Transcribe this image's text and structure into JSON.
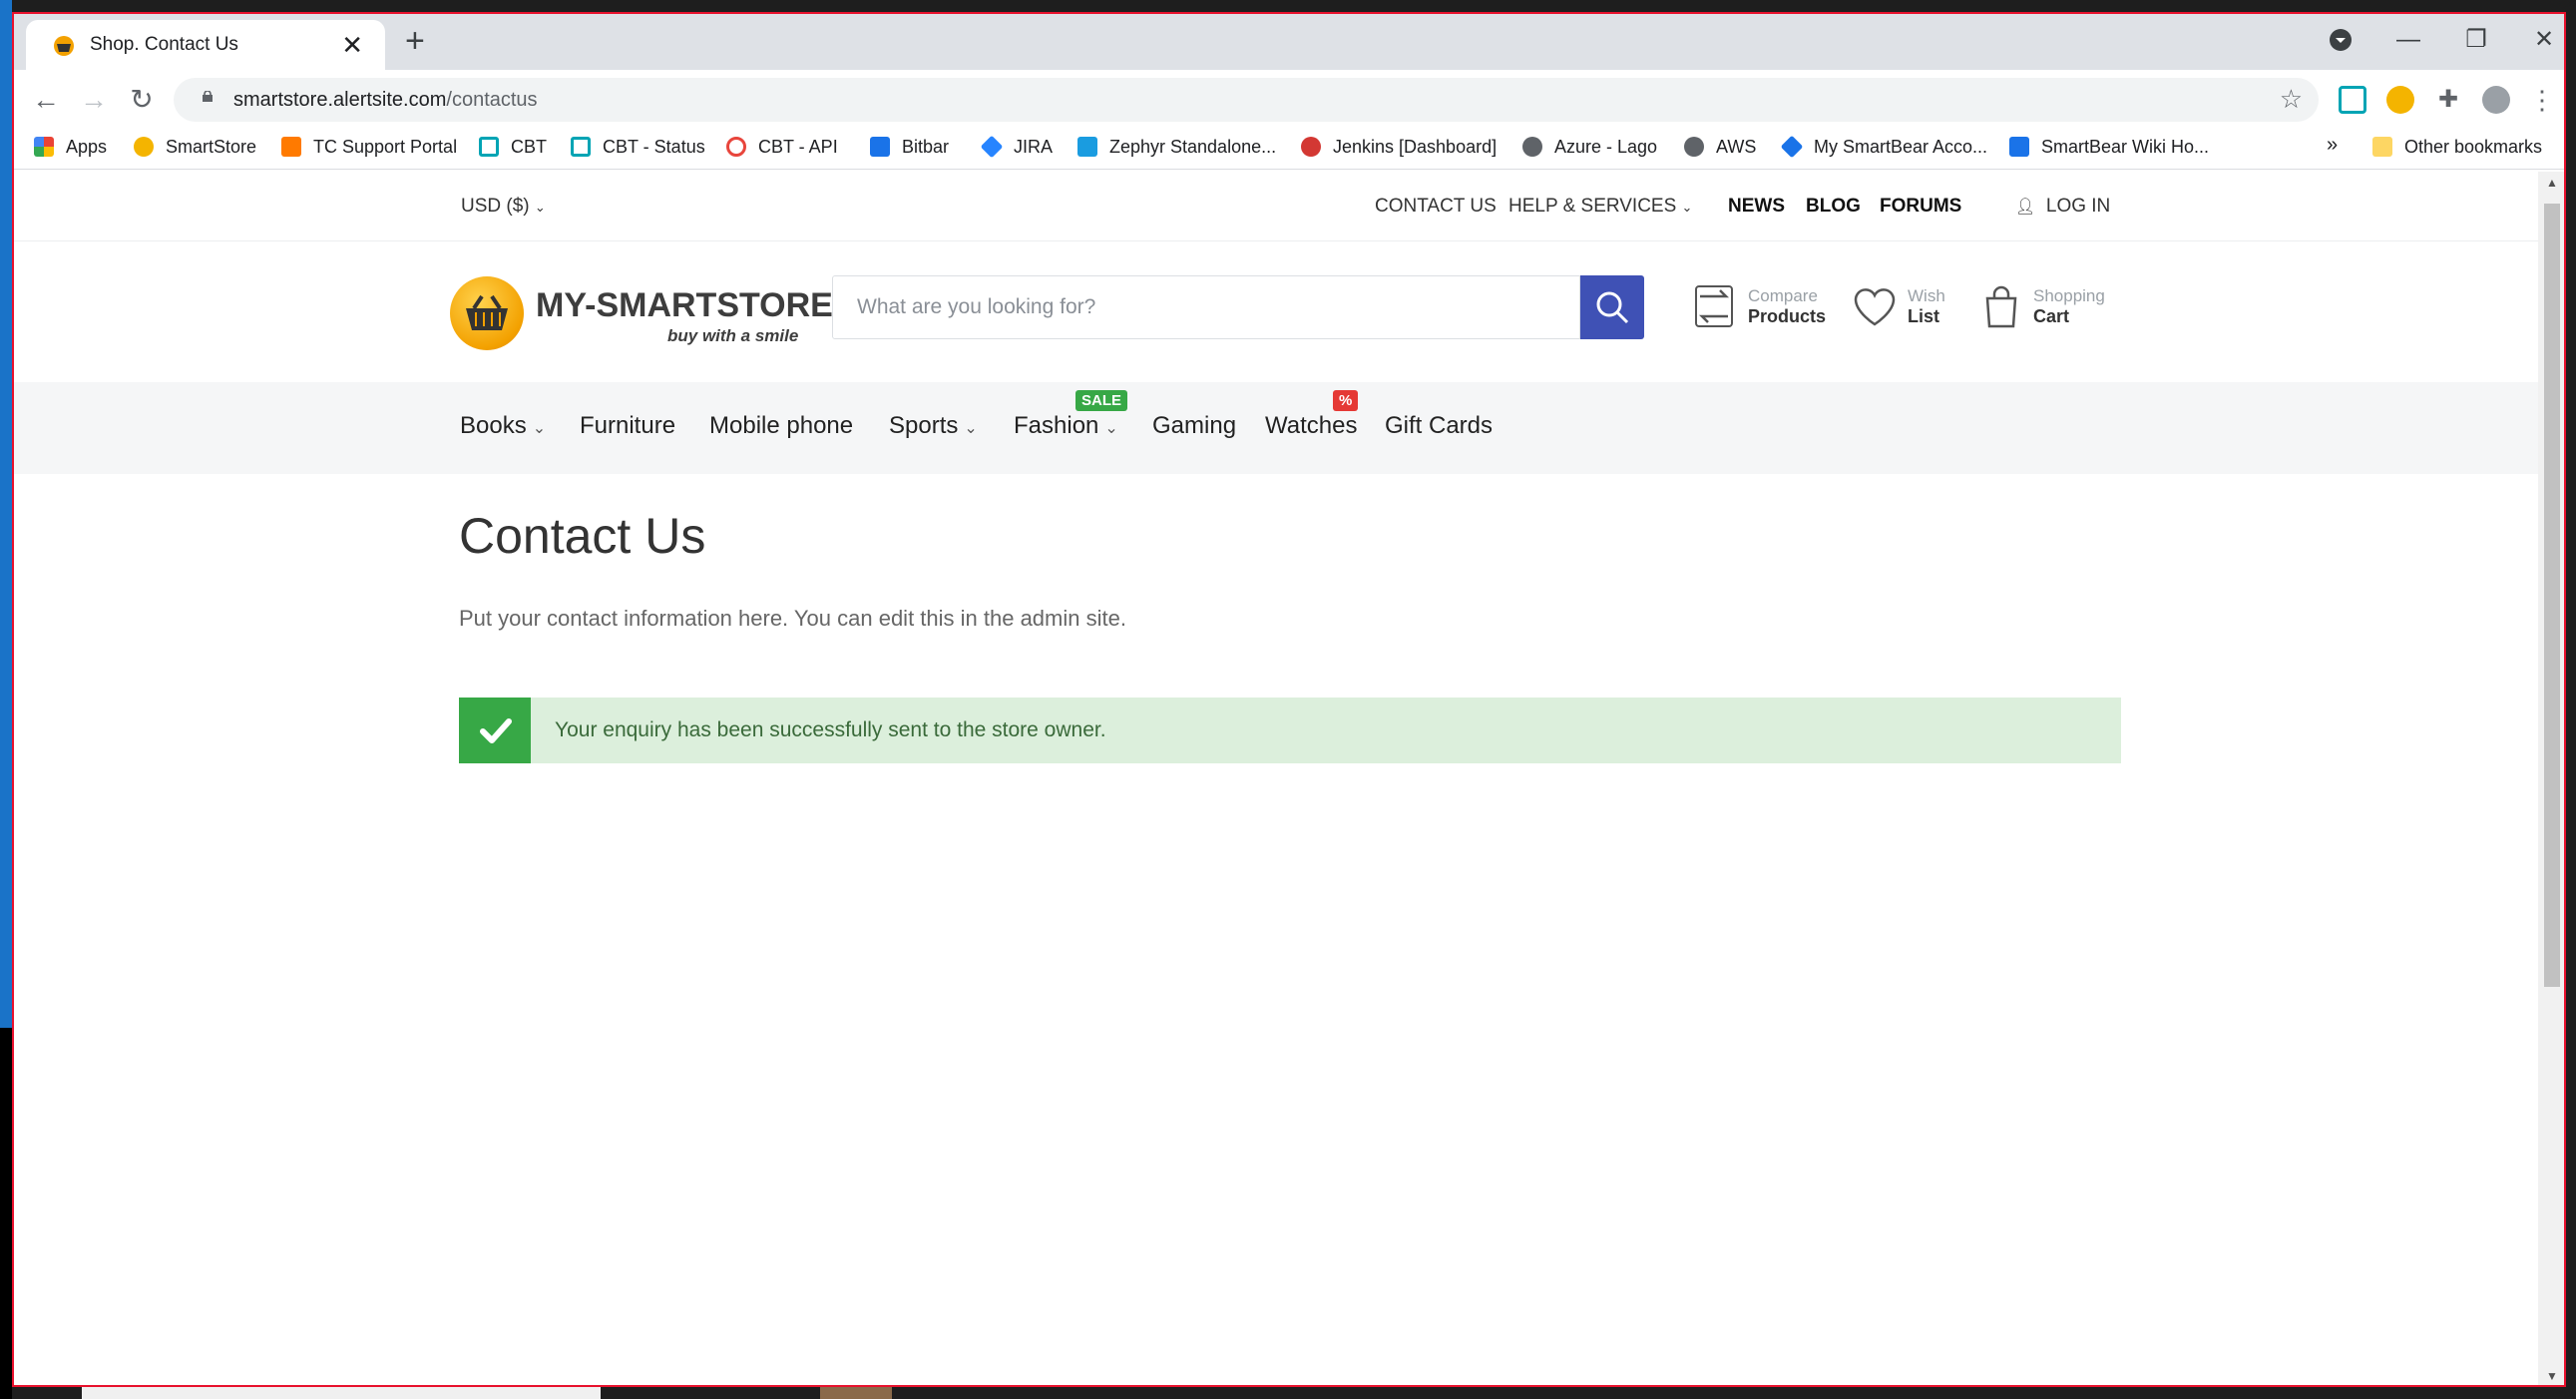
{
  "browser": {
    "tab_title": "Shop. Contact Us",
    "tab_close": "✕",
    "new_tab": "+",
    "url_host": "smartstore.alertsite.com",
    "url_path": "/contactus",
    "bookmarks": [
      {
        "label": "Apps",
        "color": "#ea4335"
      },
      {
        "label": "SmartStore",
        "color": "#f4b400"
      },
      {
        "label": "TC Support Portal",
        "color": "#ff7a00"
      },
      {
        "label": "CBT",
        "color": "#00a4b4"
      },
      {
        "label": "CBT - Status",
        "color": "#00a4b4"
      },
      {
        "label": "CBT - API",
        "color": "#e8453c"
      },
      {
        "label": "Bitbar",
        "color": "#1a73e8"
      },
      {
        "label": "JIRA",
        "color": "#2684ff"
      },
      {
        "label": "Zephyr Standalone...",
        "color": "#1a9ce0"
      },
      {
        "label": "Jenkins [Dashboard]",
        "color": "#d33833"
      },
      {
        "label": "Azure - Lago",
        "color": "#5f6368"
      },
      {
        "label": "AWS",
        "color": "#5f6368"
      },
      {
        "label": "My SmartBear Acco...",
        "color": "#1a73e8"
      },
      {
        "label": "SmartBear Wiki Ho...",
        "color": "#1a73e8"
      }
    ],
    "more": "»",
    "other_bookmarks": "Other bookmarks"
  },
  "topbar": {
    "currency": "USD ($)",
    "contact": "CONTACT US",
    "help": "HELP & SERVICES",
    "news": "NEWS",
    "blog": "BLOG",
    "forums": "FORUMS",
    "login": "LOG IN"
  },
  "header": {
    "logo_text": "MY-SMARTSTORE",
    "logo_tagline": "buy with a smile",
    "search_placeholder": "What are you looking for?",
    "compare_small": "Compare",
    "compare_big": "Products",
    "wish_small": "Wish",
    "wish_big": "List",
    "cart_small": "Shopping",
    "cart_big": "Cart"
  },
  "menu": {
    "items": [
      "Books",
      "Furniture",
      "Mobile phone",
      "Sports",
      "Fashion",
      "Gaming",
      "Watches",
      "Gift Cards"
    ],
    "sale_badge": "SALE",
    "percent_badge": "%"
  },
  "content": {
    "title": "Contact Us",
    "intro": "Put your contact information here. You can edit this in the admin site.",
    "success": "Your enquiry has been successfully sent to the store owner."
  },
  "colors": {
    "accent": "#3f51b5",
    "success_bg": "#dcefdc",
    "success_icon": "#37a846",
    "sale_badge": "#37a846",
    "percent_badge": "#e53935",
    "frame": "#e8112d"
  }
}
